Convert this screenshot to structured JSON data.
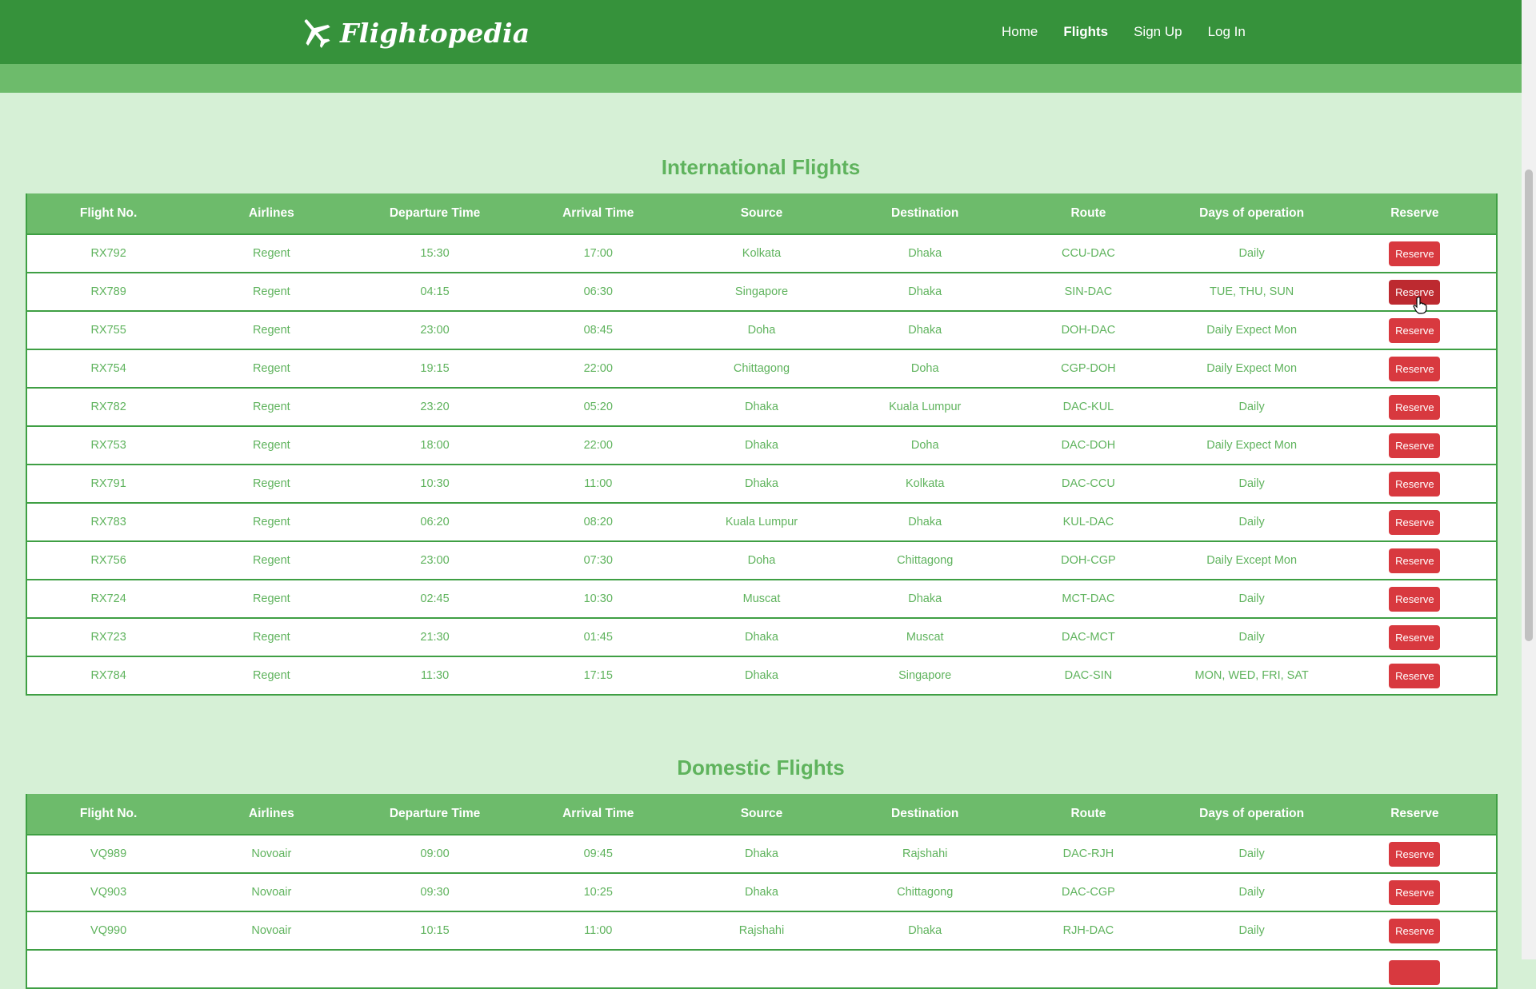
{
  "brand": {
    "name": "Flightopedia",
    "logo_icon": "airplane-icon"
  },
  "nav": [
    {
      "label": "Home",
      "active": false
    },
    {
      "label": "Flights",
      "active": true
    },
    {
      "label": "Sign Up",
      "active": false
    },
    {
      "label": "Log In",
      "active": false
    }
  ],
  "columns": [
    "Flight No.",
    "Airlines",
    "Departure Time",
    "Arrival Time",
    "Source",
    "Destination",
    "Route",
    "Days of operation",
    "Reserve"
  ],
  "international": {
    "title": "International Flights",
    "rows": [
      [
        "RX792",
        "Regent",
        "15:30",
        "17:00",
        "Kolkata",
        "Dhaka",
        "CCU-DAC",
        "Daily"
      ],
      [
        "RX789",
        "Regent",
        "04:15",
        "06:30",
        "Singapore",
        "Dhaka",
        "SIN-DAC",
        "TUE, THU, SUN"
      ],
      [
        "RX755",
        "Regent",
        "23:00",
        "08:45",
        "Doha",
        "Dhaka",
        "DOH-DAC",
        "Daily Expect Mon"
      ],
      [
        "RX754",
        "Regent",
        "19:15",
        "22:00",
        "Chittagong",
        "Doha",
        "CGP-DOH",
        "Daily Expect Mon"
      ],
      [
        "RX782",
        "Regent",
        "23:20",
        "05:20",
        "Dhaka",
        "Kuala Lumpur",
        "DAC-KUL",
        "Daily"
      ],
      [
        "RX753",
        "Regent",
        "18:00",
        "22:00",
        "Dhaka",
        "Doha",
        "DAC-DOH",
        "Daily Expect Mon"
      ],
      [
        "RX791",
        "Regent",
        "10:30",
        "11:00",
        "Dhaka",
        "Kolkata",
        "DAC-CCU",
        "Daily"
      ],
      [
        "RX783",
        "Regent",
        "06:20",
        "08:20",
        "Kuala Lumpur",
        "Dhaka",
        "KUL-DAC",
        "Daily"
      ],
      [
        "RX756",
        "Regent",
        "23:00",
        "07:30",
        "Doha",
        "Chittagong",
        "DOH-CGP",
        "Daily Except Mon"
      ],
      [
        "RX724",
        "Regent",
        "02:45",
        "10:30",
        "Muscat",
        "Dhaka",
        "MCT-DAC",
        "Daily"
      ],
      [
        "RX723",
        "Regent",
        "21:30",
        "01:45",
        "Dhaka",
        "Muscat",
        "DAC-MCT",
        "Daily"
      ],
      [
        "RX784",
        "Regent",
        "11:30",
        "17:15",
        "Dhaka",
        "Singapore",
        "DAC-SIN",
        "MON, WED, FRI, SAT"
      ]
    ]
  },
  "domestic": {
    "title": "Domestic Flights",
    "rows": [
      [
        "VQ989",
        "Novoair",
        "09:00",
        "09:45",
        "Dhaka",
        "Rajshahi",
        "DAC-RJH",
        "Daily"
      ],
      [
        "VQ903",
        "Novoair",
        "09:30",
        "10:25",
        "Dhaka",
        "Chittagong",
        "DAC-CGP",
        "Daily"
      ],
      [
        "VQ990",
        "Novoair",
        "10:15",
        "11:00",
        "Rajshahi",
        "Dhaka",
        "RJH-DAC",
        "Daily"
      ],
      [
        "",
        "",
        "",
        "",
        "",
        "",
        "",
        "",
        ""
      ]
    ]
  },
  "reserve_label": "Reserve",
  "colors": {
    "nav": "#36923b",
    "accent": "#6dbb6b",
    "text": "#5fb35d",
    "button": "#d8393f",
    "background": "#d6f0d6"
  }
}
